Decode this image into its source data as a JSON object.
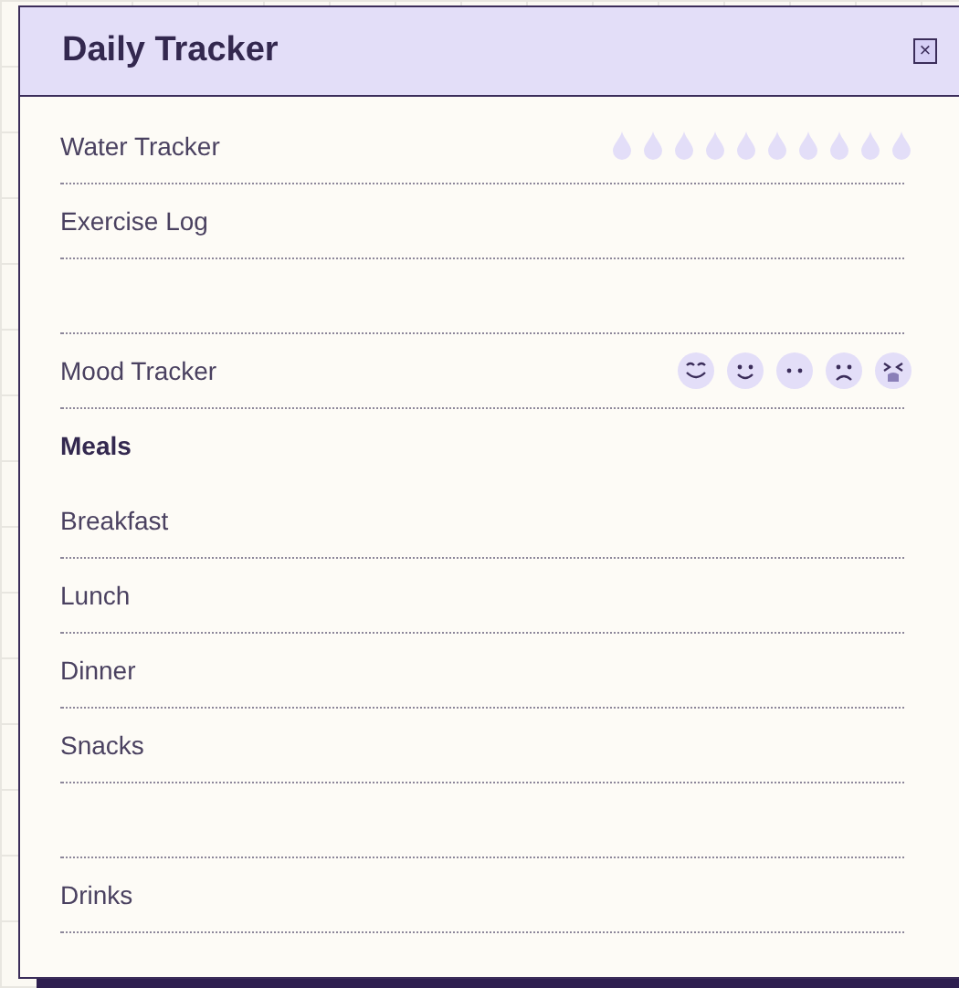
{
  "window": {
    "title": "Daily Tracker",
    "close_label": "×"
  },
  "rows": [
    {
      "kind": "water",
      "label": "Water Tracker"
    },
    {
      "kind": "label",
      "label": "Exercise Log"
    },
    {
      "kind": "blank"
    },
    {
      "kind": "mood",
      "label": "Mood Tracker"
    },
    {
      "kind": "heading",
      "label": "Meals"
    },
    {
      "kind": "label",
      "label": "Breakfast"
    },
    {
      "kind": "label",
      "label": "Lunch"
    },
    {
      "kind": "label",
      "label": "Dinner"
    },
    {
      "kind": "label",
      "label": "Snacks"
    },
    {
      "kind": "blank"
    },
    {
      "kind": "label",
      "label": "Drinks"
    }
  ]
}
